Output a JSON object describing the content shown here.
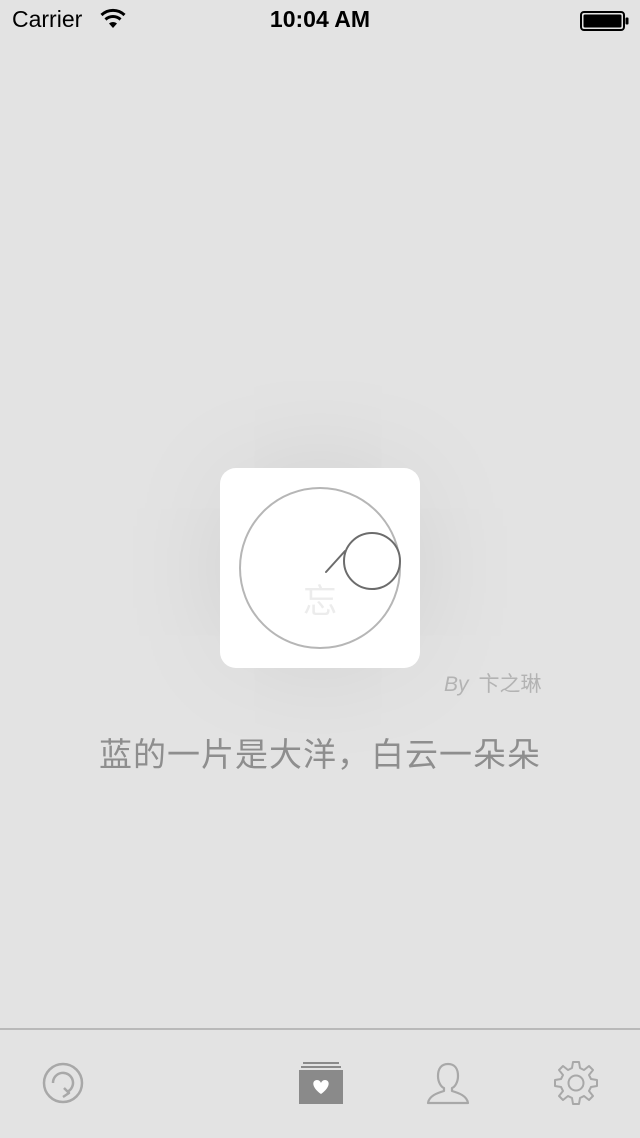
{
  "status_bar": {
    "carrier": "Carrier",
    "time": "10:04 AM"
  },
  "logo": {
    "character": "忘"
  },
  "quote": {
    "by_label": "By",
    "author": "卞之琳",
    "text": "蓝的一片是大洋，白云一朵朵"
  },
  "tab_bar": {
    "items": [
      {
        "icon": "refresh-icon",
        "selected": false
      },
      {
        "icon": "heart-box-icon",
        "selected": true
      },
      {
        "icon": "user-icon",
        "selected": false
      },
      {
        "icon": "gear-icon",
        "selected": false
      }
    ]
  },
  "colors": {
    "background": "#e3e3e3",
    "tab_icon": "#a8a8a8",
    "tab_icon_selected": "#8a8a8a",
    "text": "#8e8e8e"
  }
}
